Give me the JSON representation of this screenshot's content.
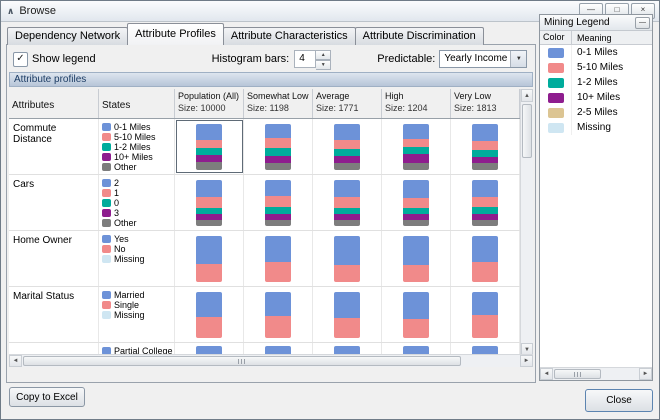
{
  "window": {
    "title": "Browse",
    "icons": {
      "window": "∧",
      "minimize": "—",
      "maximize": "□",
      "close": "×"
    }
  },
  "tabs": [
    {
      "label": "Dependency Network",
      "active": false
    },
    {
      "label": "Attribute Profiles",
      "active": true
    },
    {
      "label": "Attribute Characteristics",
      "active": false
    },
    {
      "label": "Attribute Discrimination",
      "active": false
    }
  ],
  "toolbar": {
    "show_legend_label": "Show legend",
    "show_legend_checked": true,
    "check_glyph": "✓",
    "histogram_bars_label": "Histogram bars:",
    "histogram_bars_value": "4",
    "spin_up": "▲",
    "spin_down": "▼",
    "predictable_label": "Predictable:",
    "predictable_value": "Yearly Income",
    "combo_arrow": "▼"
  },
  "palette": {
    "blue": "#6d92d8",
    "salmon": "#f18a8a",
    "teal": "#00ac9c",
    "purple": "#8e1d8e",
    "gray": "#7d7d7d",
    "khaki": "#dcc593",
    "missing": "#cfe6f2"
  },
  "profiles": {
    "header_label": "Attribute profiles",
    "columns": [
      {
        "title": "Attributes",
        "size": ""
      },
      {
        "title": "States",
        "size": ""
      },
      {
        "title": "Population (All)",
        "size": "Size: 10000"
      },
      {
        "title": "Somewhat Low",
        "size": "Size: 1198"
      },
      {
        "title": "Average",
        "size": "Size: 1771"
      },
      {
        "title": "High",
        "size": "Size: 1204"
      },
      {
        "title": "Very Low",
        "size": "Size: 1813"
      }
    ],
    "selected_cell": {
      "row": 0,
      "hist_col": 0
    },
    "rows": [
      {
        "attribute": "Commute Distance",
        "states": [
          {
            "label": "0-1 Miles",
            "color": "blue"
          },
          {
            "label": "5-10 Miles",
            "color": "salmon"
          },
          {
            "label": "1-2 Miles",
            "color": "teal"
          },
          {
            "label": "10+ Miles",
            "color": "purple"
          },
          {
            "label": "Other",
            "color": "gray"
          }
        ],
        "bar_colors": [
          "blue",
          "salmon",
          "teal",
          "purple",
          "gray"
        ],
        "histograms": [
          [
            34,
            18,
            15,
            16,
            17
          ],
          [
            31,
            22,
            16,
            15,
            16
          ],
          [
            35,
            19,
            15,
            15,
            16
          ],
          [
            33,
            17,
            16,
            18,
            16
          ],
          [
            37,
            20,
            14,
            14,
            15
          ]
        ]
      },
      {
        "attribute": "Cars",
        "states": [
          {
            "label": "2",
            "color": "blue"
          },
          {
            "label": "1",
            "color": "salmon"
          },
          {
            "label": "0",
            "color": "teal"
          },
          {
            "label": "3",
            "color": "purple"
          },
          {
            "label": "Other",
            "color": "gray"
          }
        ],
        "bar_colors": [
          "blue",
          "salmon",
          "teal",
          "purple",
          "gray"
        ],
        "histograms": [
          [
            38,
            22,
            14,
            13,
            13
          ],
          [
            35,
            24,
            15,
            13,
            13
          ],
          [
            38,
            22,
            14,
            13,
            13
          ],
          [
            40,
            20,
            14,
            13,
            13
          ],
          [
            36,
            22,
            15,
            14,
            13
          ]
        ]
      },
      {
        "attribute": "Home Owner",
        "states": [
          {
            "label": "Yes",
            "color": "blue"
          },
          {
            "label": "No",
            "color": "salmon"
          },
          {
            "label": "Missing",
            "color": "missing"
          }
        ],
        "bar_colors": [
          "blue",
          "salmon"
        ],
        "histograms": [
          [
            60,
            40
          ],
          [
            57,
            43
          ],
          [
            62,
            38
          ],
          [
            64,
            36
          ],
          [
            56,
            44
          ]
        ]
      },
      {
        "attribute": "Marital Status",
        "states": [
          {
            "label": "Married",
            "color": "blue"
          },
          {
            "label": "Single",
            "color": "salmon"
          },
          {
            "label": "Missing",
            "color": "missing"
          }
        ],
        "bar_colors": [
          "blue",
          "salmon"
        ],
        "histograms": [
          [
            54,
            46
          ],
          [
            52,
            48
          ],
          [
            56,
            44
          ],
          [
            58,
            42
          ],
          [
            50,
            50
          ]
        ]
      },
      {
        "attribute": "",
        "clipped": true,
        "states": [
          {
            "label": "Partial College",
            "color": "blue"
          }
        ],
        "bar_colors": [
          "blue"
        ],
        "histograms": [
          [
            100
          ],
          [
            100
          ],
          [
            100
          ],
          [
            100
          ],
          [
            100
          ]
        ]
      }
    ]
  },
  "scrollbars": {
    "left_arrow": "◄",
    "right_arrow": "►",
    "up_arrow": "▲",
    "down_arrow": "▼"
  },
  "mining_legend": {
    "title": "Mining Legend",
    "button_glyph": "—",
    "columns": {
      "color": "Color",
      "meaning": "Meaning"
    },
    "rows": [
      {
        "color": "blue",
        "meaning": "0-1 Miles"
      },
      {
        "color": "salmon",
        "meaning": "5-10 Miles"
      },
      {
        "color": "teal",
        "meaning": "1-2 Miles"
      },
      {
        "color": "purple",
        "meaning": "10+ Miles"
      },
      {
        "color": "khaki",
        "meaning": "2-5 Miles"
      },
      {
        "color": "missing",
        "meaning": "Missing"
      }
    ]
  },
  "footer": {
    "copy_to_excel": "Copy to Excel",
    "close": "Close"
  }
}
